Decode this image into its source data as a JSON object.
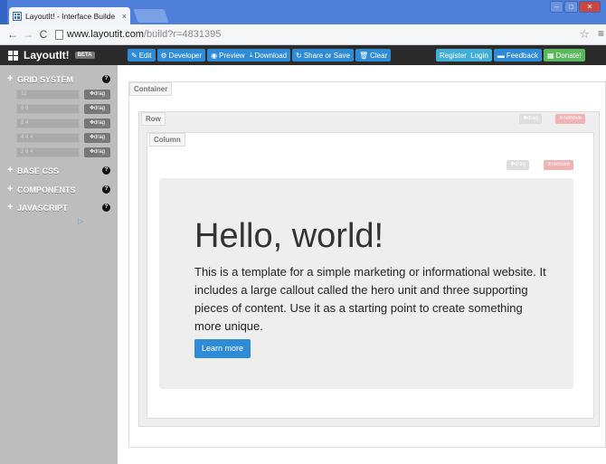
{
  "browser": {
    "tab_title": "LayoutIt! - Interface Builde",
    "tab_close": "×",
    "url_host": "www.layoutit.com",
    "url_path": "/build?r=4831395",
    "window_controls": [
      "–",
      "□",
      "✕"
    ]
  },
  "navbar": {
    "brand": "LayoutIt!",
    "badge": "BETA",
    "actions": [
      {
        "icon": "✎",
        "label": "Edit"
      },
      {
        "icon": "⚙",
        "label": "Developer"
      },
      {
        "icon": "◉",
        "label": "Preview"
      }
    ],
    "file_actions": [
      {
        "icon": "⤓",
        "label": "Download"
      },
      {
        "icon": "↻",
        "label": "Share or Save"
      },
      {
        "icon": "🗑",
        "label": "Clear"
      }
    ],
    "register_login": "Register  Login",
    "feedback": "Feedback",
    "donate": "Donate!"
  },
  "sidebar": {
    "sections": [
      {
        "label": "GRID SYSTEM"
      },
      {
        "label": "BASE CSS"
      },
      {
        "label": "COMPONENTS"
      },
      {
        "label": "JAVASCRIPT"
      }
    ],
    "grid_rows": [
      "12",
      "6 6",
      "8 4",
      "4 4 4",
      "2 6 4"
    ],
    "drag_label": "drag"
  },
  "canvas": {
    "container_label": "Container",
    "row_label": "Row",
    "column_label": "Column",
    "drag_label": "drag",
    "remove_label": "remove",
    "hero_title": "Hello, world!",
    "hero_text": "This is a template for a simple marketing or informational website. It includes a large callout called the hero unit and three supporting pieces of content. Use it as a starting point to create something more unique.",
    "learn_more": "Learn more"
  }
}
